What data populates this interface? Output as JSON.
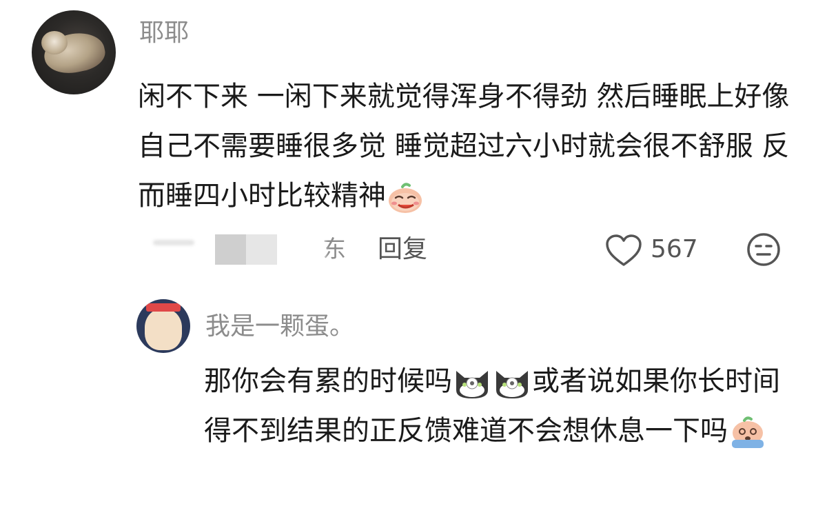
{
  "comment": {
    "username": "耶耶",
    "text": "闲不下来 一闲下来就觉得浑身不得劲 然后睡眠上好像自己不需要睡很多觉 睡觉超过六小时就会很不舒服 反而睡四小时比较精神",
    "trailing_emoji": "smirk-face-emoji",
    "location_suffix": "东",
    "reply_label": "回复",
    "like_count": "567"
  },
  "reply": {
    "username": "我是一颗蛋。",
    "text_part1": "那你会有累的时候吗",
    "inline_emoji": "cat-face-emoji",
    "text_part2": "或者说如果你长时间得不到结果的正反馈难道不会想休息一下吗",
    "trailing_emoji": "crying-face-emoji"
  },
  "colors": {
    "text_primary": "#1a1a1a",
    "text_secondary": "#8c8c8c",
    "action_text": "#555555",
    "background": "#ffffff"
  }
}
